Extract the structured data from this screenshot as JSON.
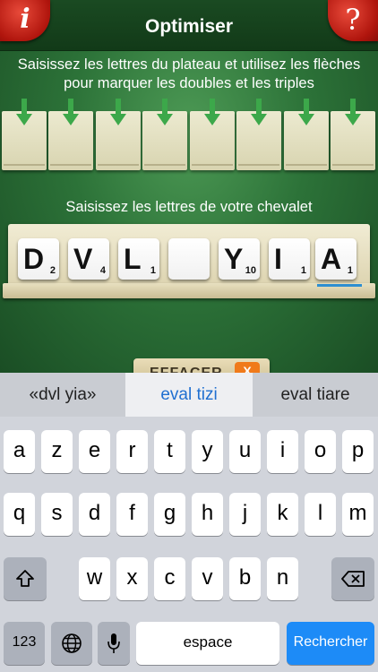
{
  "header": {
    "title": "Optimiser",
    "info_label": "i",
    "help_label": "?"
  },
  "instruction": "Saisissez les lettres du plateau et utilisez les flèches pour marquer les doubles et les triples",
  "rack_label": "Saisissez les lettres de votre chevalet",
  "rack_tiles": [
    {
      "letter": "D",
      "points": "2"
    },
    {
      "letter": "V",
      "points": "4"
    },
    {
      "letter": "L",
      "points": "1"
    },
    {
      "letter": "",
      "points": ""
    },
    {
      "letter": "Y",
      "points": "10"
    },
    {
      "letter": "I",
      "points": "1"
    },
    {
      "letter": "A",
      "points": "1"
    }
  ],
  "erase_button": {
    "label": "EFFACER",
    "badge": "X"
  },
  "keyboard": {
    "suggestions": [
      "«dvl yia»",
      "eval tizi",
      "eval tiare"
    ],
    "row1": [
      "a",
      "z",
      "e",
      "r",
      "t",
      "y",
      "u",
      "i",
      "o",
      "p"
    ],
    "row2": [
      "q",
      "s",
      "d",
      "f",
      "g",
      "h",
      "j",
      "k",
      "l",
      "m"
    ],
    "row3": [
      "w",
      "x",
      "c",
      "v",
      "b",
      "n"
    ],
    "numbers_label": "123",
    "space_label": "espace",
    "search_label": "Rechercher"
  },
  "colors": {
    "accent": "#1d8bf7",
    "corner_red": "#c81a10",
    "felt_green": "#2c7238"
  }
}
